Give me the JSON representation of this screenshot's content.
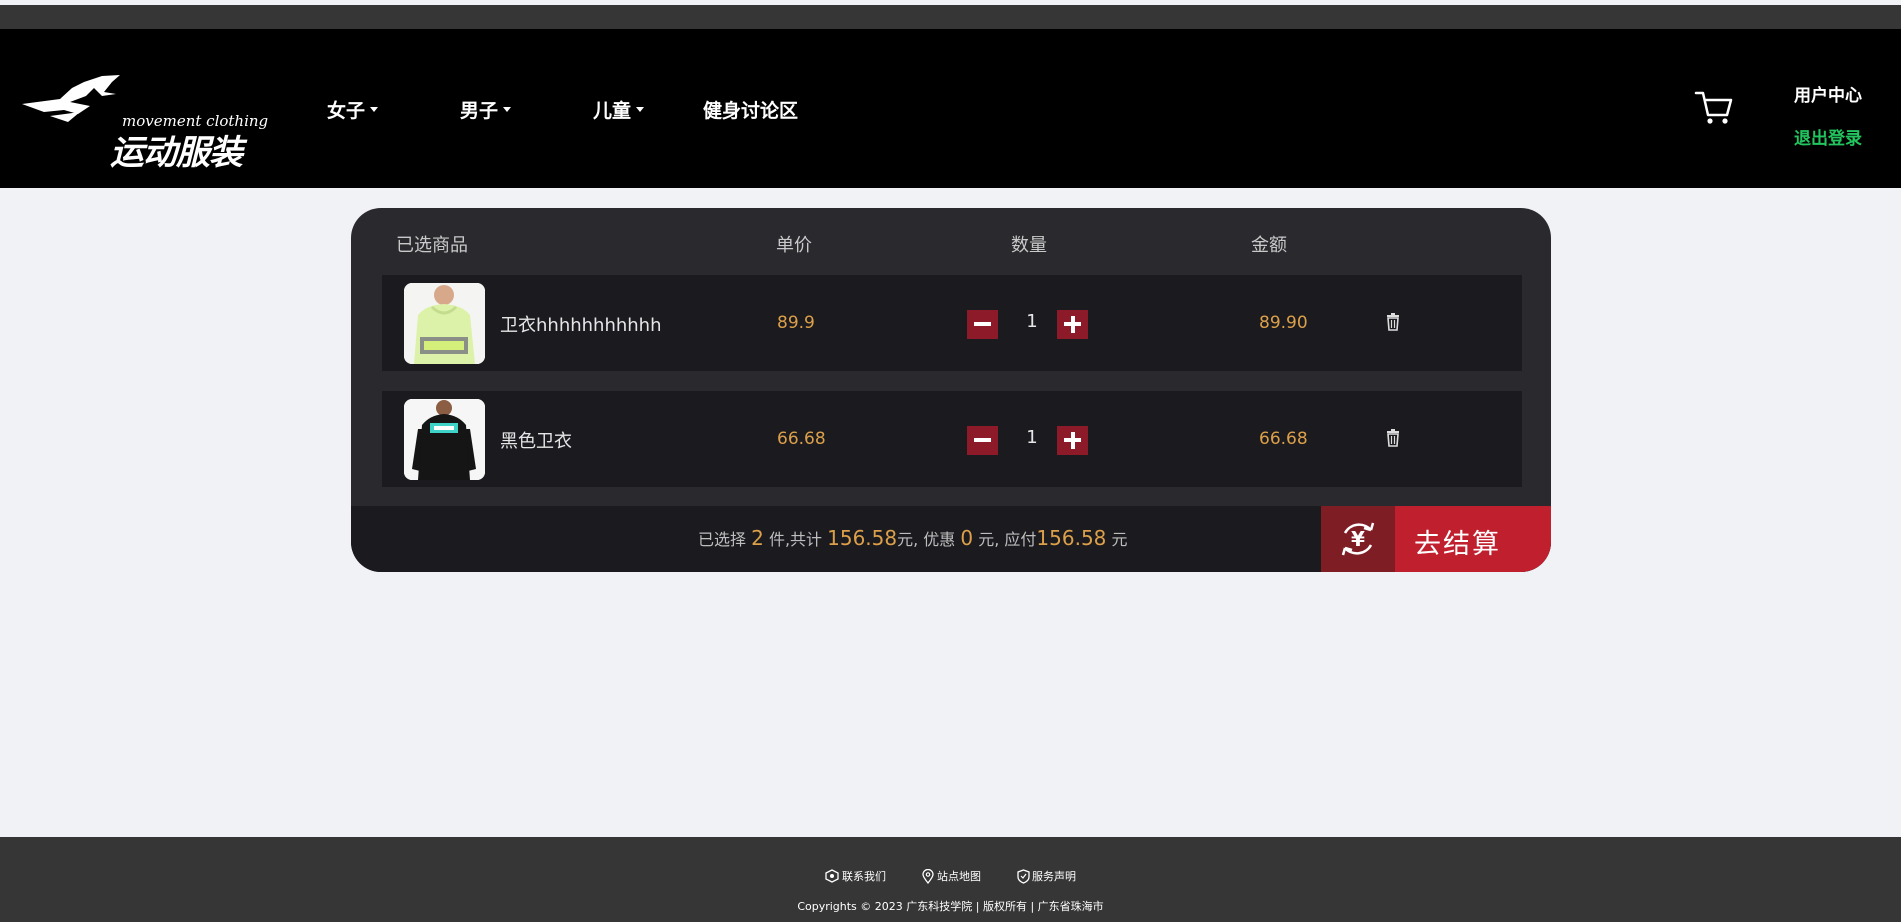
{
  "brand": {
    "logo_en": "movement clothing",
    "logo_cn": "运动服装"
  },
  "nav": [
    {
      "label": "女子",
      "has_dropdown": true
    },
    {
      "label": "男子",
      "has_dropdown": true
    },
    {
      "label": "儿童",
      "has_dropdown": true
    },
    {
      "label": "健身讨论区",
      "has_dropdown": false
    }
  ],
  "user": {
    "center_label": "用户中心",
    "logout_label": "退出登录"
  },
  "cart": {
    "headers": {
      "product": "已选商品",
      "unit_price": "单价",
      "quantity": "数量",
      "amount": "金额"
    },
    "items": [
      {
        "name": "卫衣hhhhhhhhhhh",
        "price": "89.9",
        "quantity": "1",
        "amount": "89.90",
        "image": "light-green NIKE F.C. hoodie"
      },
      {
        "name": "黑色卫衣",
        "price": "66.68",
        "quantity": "1",
        "amount": "66.68",
        "image": "black hoodie with teal print"
      }
    ],
    "summary": {
      "selected_prefix": "已选择",
      "selected_count": "2",
      "total_prefix": "件,共计",
      "total": "156.58",
      "discount_prefix": "元, 优惠",
      "discount": "0",
      "payable_prefix": "元, 应付",
      "payable": "156.58",
      "payable_suffix": "元"
    },
    "checkout_label": "去结算"
  },
  "footer": {
    "links": [
      {
        "label": "联系我们",
        "icon": "contact-icon"
      },
      {
        "label": "站点地图",
        "icon": "map-pin-icon"
      },
      {
        "label": "服务声明",
        "icon": "shield-icon"
      }
    ],
    "copyright": "Copyrights © 2023 广东科技学院 | 版权所有 | 广东省珠海市"
  },
  "colors": {
    "accent_price": "#dca04a",
    "button_red": "#8c1a28",
    "checkout_red": "#c01f2e",
    "logout_green": "#22c55e"
  }
}
